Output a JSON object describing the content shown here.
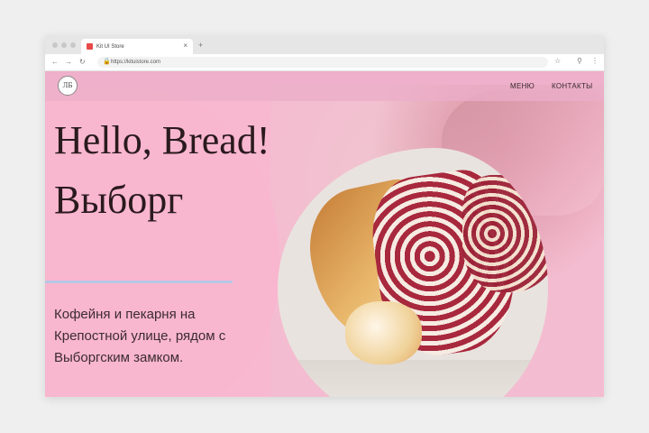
{
  "browser": {
    "tab_title": "Kit UI Store",
    "tab_close": "×",
    "new_tab": "+",
    "nav_back": "←",
    "nav_forward": "→",
    "nav_reload": "↻",
    "lock": "🔒",
    "url": "https://kituistore.com",
    "bookmark": "☆",
    "extensions": "⋮"
  },
  "site": {
    "logo_text": "ЛБ",
    "nav": [
      {
        "label": "МЕНЮ"
      },
      {
        "label": "КОНТАКТЫ"
      }
    ],
    "hero": {
      "title_line1": "Hello, Bread!",
      "title_line2": "Выборг",
      "description": "Кофейня и пекарня на Крепостной улице, рядом с Выборгским замком."
    }
  },
  "colors": {
    "accent_pink": "#f8b8d0",
    "divider": "#b9c6e6"
  }
}
